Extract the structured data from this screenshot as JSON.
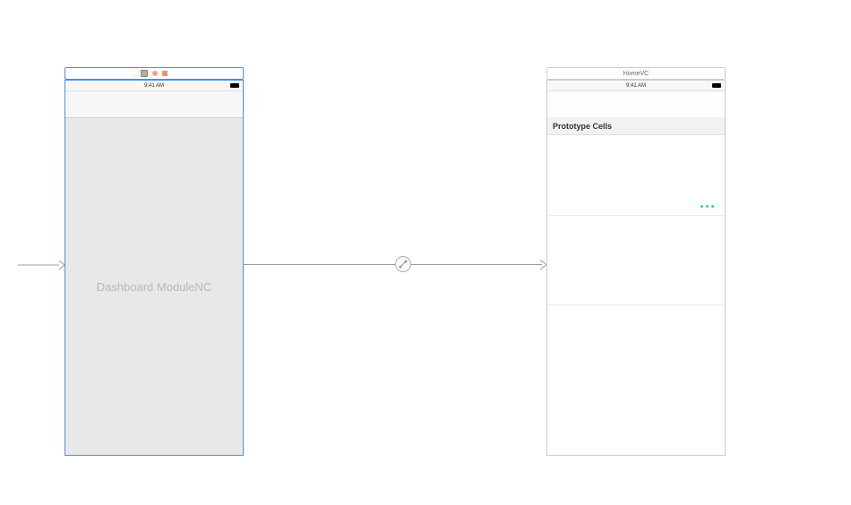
{
  "scene1": {
    "status_time": "9:41 AM",
    "content_label": "Dashboard ModuleNC"
  },
  "scene2": {
    "header_title": "HomeVC",
    "status_time": "9:41 AM",
    "table_header": "Prototype Cells"
  }
}
